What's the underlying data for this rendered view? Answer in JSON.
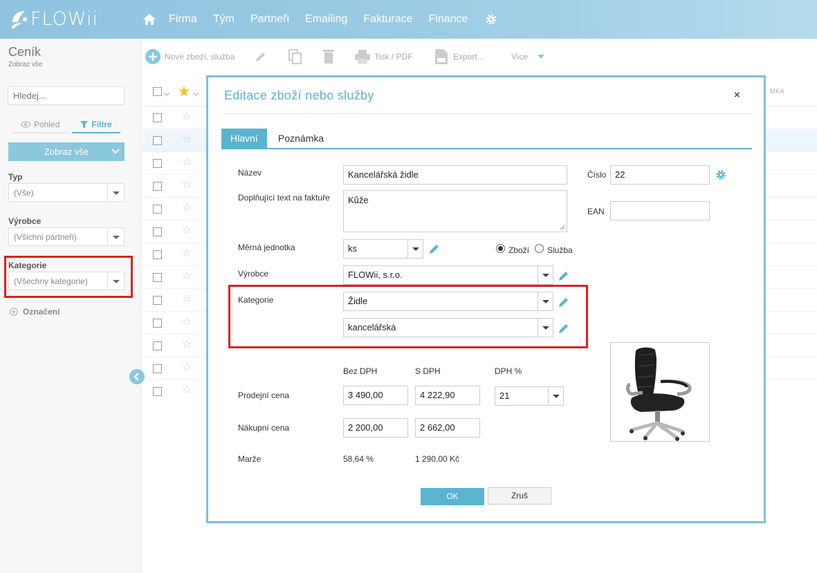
{
  "app": {
    "logo": "FLOWii",
    "nav": [
      "Firma",
      "Tým",
      "Partneři",
      "Emailing",
      "Fakturace",
      "Finance"
    ]
  },
  "left_panel": {
    "title": "Ceník",
    "subtitle": "Zobraz vše",
    "search_placeholder": "Hledej...",
    "tab_pohled": "Pohled",
    "tab_filtre": "Filtre",
    "show_all_button": "Zobraz vše",
    "filters": [
      {
        "label": "Typ",
        "value": "(Vše)"
      },
      {
        "label": "Výrobce",
        "value": "(Všichni partneři)"
      },
      {
        "label": "Kategorie",
        "value": "(Všechny kategorie)"
      }
    ],
    "oznaceni": "Označení"
  },
  "toolbar": {
    "new_item": "Nové zboží, služba",
    "print": "Tisk / PDF",
    "export": "Export...",
    "more": "Více"
  },
  "grid": {
    "header_right": "MKA",
    "row_count": 13
  },
  "modal": {
    "title": "Editace zboží nebo služby",
    "close": "×",
    "tabs": {
      "main": "Hlavní",
      "note": "Poznámka"
    },
    "fields": {
      "nazev_label": "Název",
      "nazev_value": "Kancelářská židle",
      "cislo_label": "Číslo",
      "cislo_value": "22",
      "doplnujici_label": "Doplňující text na faktuře",
      "doplnujici_value": "Kůže",
      "ean_label": "EAN",
      "ean_value": "",
      "jednotka_label": "Měrná jednotka",
      "jednotka_value": "ks",
      "radio_zbozi": "Zboží",
      "radio_sluzba": "Služba",
      "vyrobce_label": "Výrobce",
      "vyrobce_value": "FLOWii, s.r.o.",
      "kategorie_label": "Kategorie",
      "kategorie_value": "Židle",
      "podkategorie_value": "kancelářská"
    },
    "prices": {
      "col_bez_dph": "Bez DPH",
      "col_s_dph": "S DPH",
      "col_dph": "DPH %",
      "prodejni_label": "Prodejní cena",
      "prodejni_bez": "3 490,00",
      "prodejni_s": "4 222,90",
      "dph_value": "21",
      "nakupni_label": "Nákupní cena",
      "nakupni_bez": "2 200,00",
      "nakupni_s": "2 662,00",
      "marze_label": "Marže",
      "marze_pct": "58,64 %",
      "marze_kc": "1 290,00 Kč"
    },
    "buttons": {
      "ok": "OK",
      "cancel": "Zruš"
    }
  },
  "colors": {
    "accent": "#5ab4d0",
    "highlight": "#e01e1e",
    "topbar": "#9bcbe4"
  }
}
